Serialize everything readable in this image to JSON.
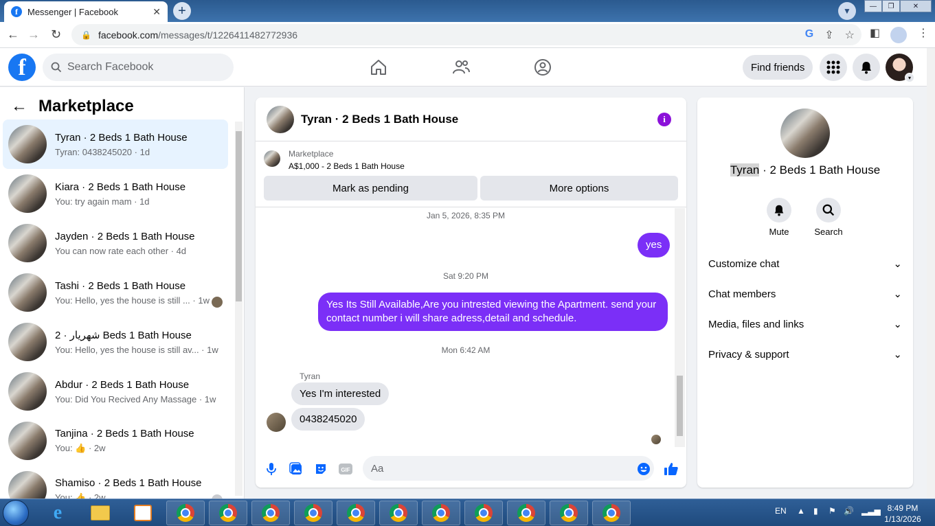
{
  "browser": {
    "tab_title": "Messenger | Facebook",
    "tab_close": "✕",
    "new_tab": "+",
    "url_host": "facebook.com",
    "url_path": "/messages/t/1226411482772936"
  },
  "fb": {
    "logo_letter": "f",
    "search_placeholder": "Search Facebook",
    "find_friends": "Find friends"
  },
  "left_panel": {
    "back_arrow": "←",
    "title": "Marketplace",
    "conversations": [
      {
        "name": "Tyran · 2 Beds 1 Bath House",
        "preview": "Tyran: 0438245020 · 1d"
      },
      {
        "name": "Kiara · 2 Beds 1 Bath House",
        "preview": "You: try again mam · 1d"
      },
      {
        "name": "Jayden · 2 Beds 1 Bath House",
        "preview": "You can now rate each other · 4d"
      },
      {
        "name": "Tashi · 2 Beds 1 Bath House",
        "preview": "You: Hello, yes the house is still ... · 1w"
      },
      {
        "name": "شهریار · 2 Beds 1 Bath House",
        "preview": "You: Hello, yes the house is still av... · 1w"
      },
      {
        "name": "Abdur · 2 Beds 1 Bath House",
        "preview": "You: Did You Recived Any Massage · 1w"
      },
      {
        "name": "Tanjina · 2 Beds 1 Bath House",
        "preview": "You: 👍 · 2w"
      },
      {
        "name": "Shamiso · 2 Beds 1 Bath House",
        "preview": "You: 👍 · 2w"
      }
    ]
  },
  "chat": {
    "title": "Tyran · 2 Beds 1 Bath House",
    "info_icon": "i",
    "marketplace_label": "Marketplace",
    "listing": "A$1,000 - 2 Beds 1 Bath House",
    "mark_pending": "Mark as pending",
    "more_options": "More options",
    "ts1": "Jan 5, 2026, 8:35 PM",
    "msg_yes": "yes",
    "ts2": "Sat 9:20 PM",
    "msg_long": "Yes Its Still Available,Are you intrested viewing the Apartment. send your contact number i will share adress,detail and schedule.",
    "ts3": "Mon 6:42 AM",
    "sender": "Tyran",
    "msg_in1": "Yes I'm interested",
    "msg_in2": "0438245020",
    "input_placeholder": "Aa"
  },
  "right_panel": {
    "title_hl": "Tyran",
    "title_rest": " · 2 Beds 1 Bath House",
    "mute": "Mute",
    "search": "Search",
    "rows": [
      "Customize chat",
      "Chat members",
      "Media, files and links",
      "Privacy & support"
    ]
  },
  "taskbar": {
    "lang": "EN",
    "time": "8:49 PM",
    "date": "1/13/2026"
  }
}
